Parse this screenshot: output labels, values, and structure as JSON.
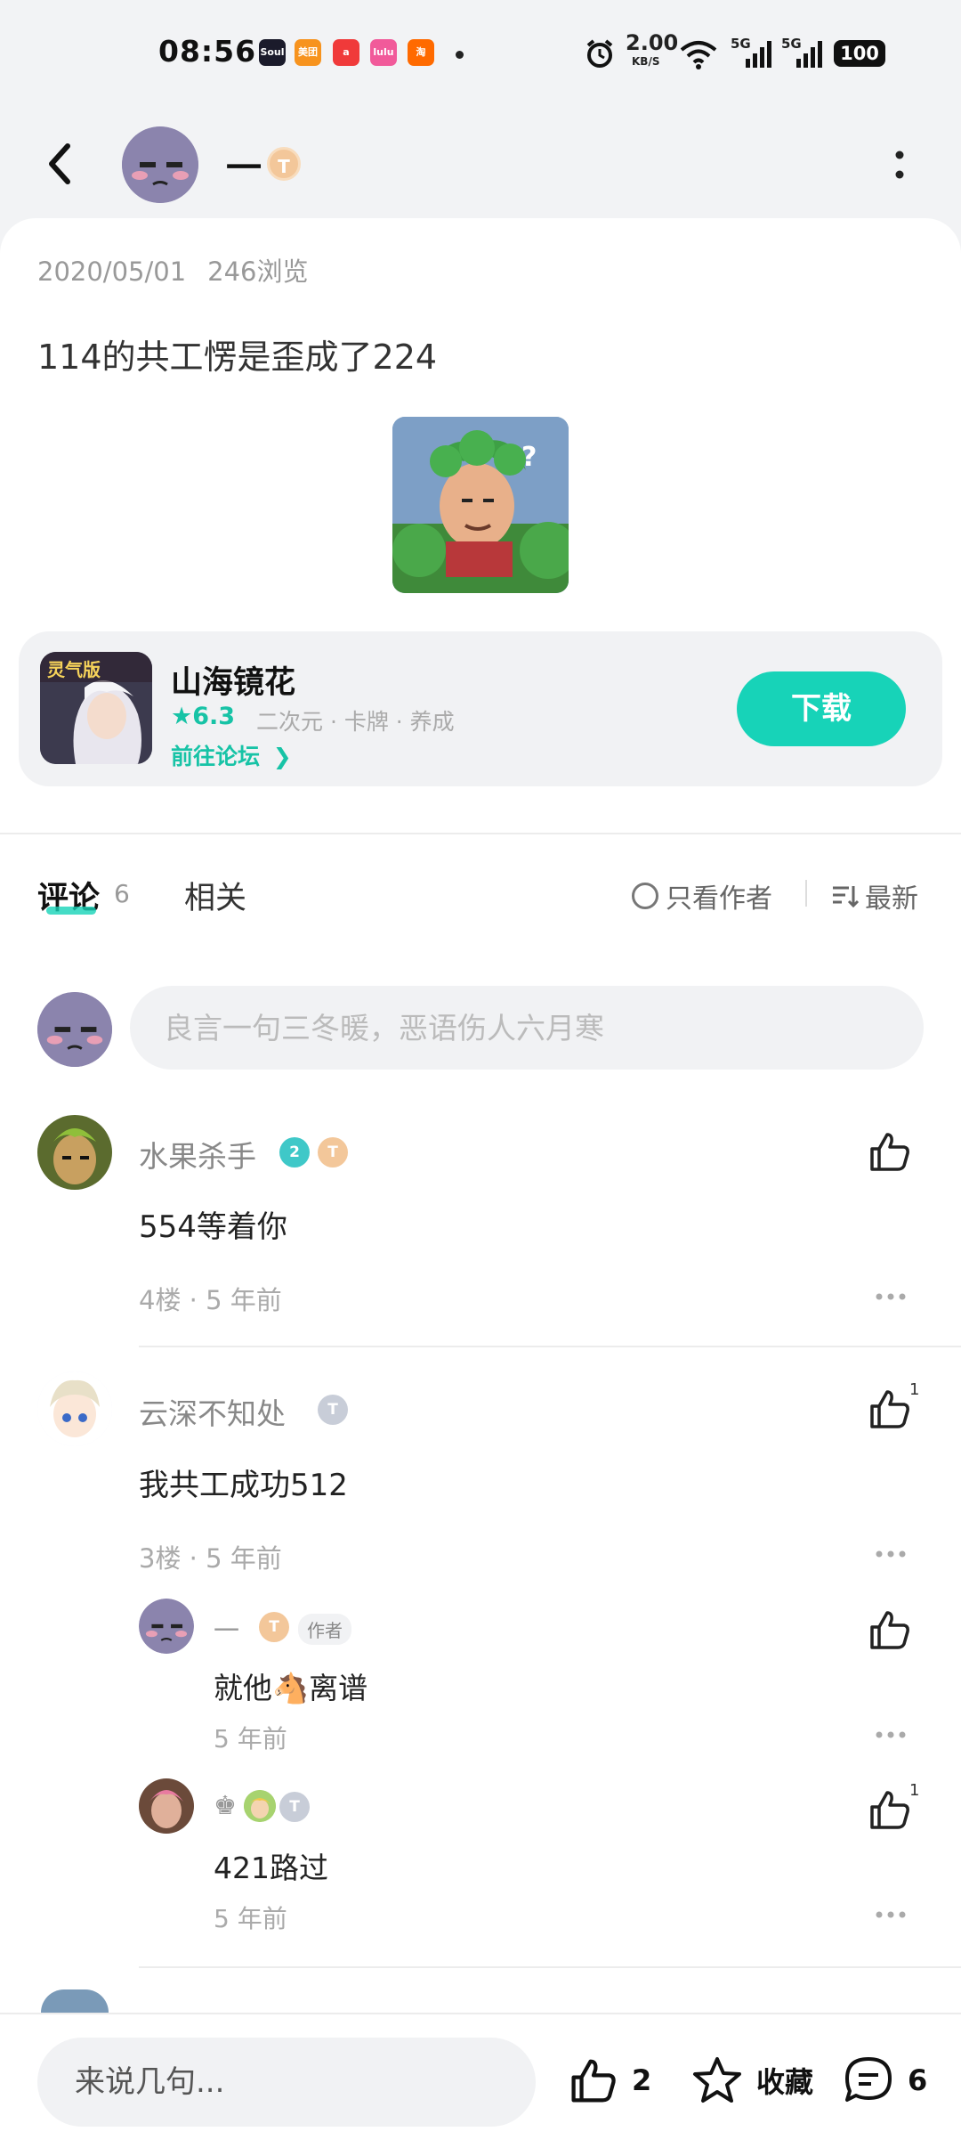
{
  "status_bar": {
    "time": "08:56",
    "apps": [
      {
        "name": "soul-app-icon",
        "label": "Soul",
        "color": "#1b1b2b"
      },
      {
        "name": "meituan-app-icon",
        "label": "美团",
        "color": "#f7931e"
      },
      {
        "name": "a-app-icon",
        "label": "a",
        "color": "#f03a3a"
      },
      {
        "name": "lulu-app-icon",
        "label": "lulu",
        "color": "#f15a9a"
      },
      {
        "name": "taobao-app-icon",
        "label": "淘",
        "color": "#ff6a00"
      }
    ],
    "net_speed": "2.00",
    "net_unit": "KB/S",
    "signal1": "5G",
    "signal2": "5G",
    "battery": "100"
  },
  "header": {
    "author_name": "一",
    "medal": "T"
  },
  "post": {
    "date": "2020/05/01",
    "views": "246浏览",
    "content": "114的共工愣是歪成了224"
  },
  "game": {
    "title": "山海镜花",
    "rating": "6.3",
    "tags": "二次元 · 卡牌 · 养成",
    "forum_link": "前往论坛",
    "download": "下载",
    "icon_text": "灵气版"
  },
  "tabs": {
    "comments": "评论",
    "comment_count": "6",
    "related": "相关",
    "only_author": "只看作者",
    "sort": "最新"
  },
  "comment_input": {
    "placeholder": "良言一句三冬暖，恶语伤人六月寒"
  },
  "comments": [
    {
      "name": "水果杀手",
      "level": "2",
      "medal": "T",
      "text": "554等着你",
      "meta": "4楼 · 5 年前",
      "likes": ""
    },
    {
      "name": "云深不知处",
      "medal": "T",
      "text": "我共工成功512",
      "meta": "3楼 · 5 年前",
      "likes": "1",
      "replies": [
        {
          "name": "一",
          "medal": "T",
          "tag": "作者",
          "text_a": "就他",
          "emoji": "🐴",
          "text_b": "离谱",
          "meta": "5 年前",
          "likes": ""
        },
        {
          "name": "♚",
          "medal": "T",
          "text": "421路过",
          "meta": "5 年前",
          "likes": "1"
        }
      ]
    }
  ],
  "bottom_bar": {
    "placeholder": "来说几句...",
    "likes": "2",
    "favorite": "收藏",
    "comments": "6"
  }
}
